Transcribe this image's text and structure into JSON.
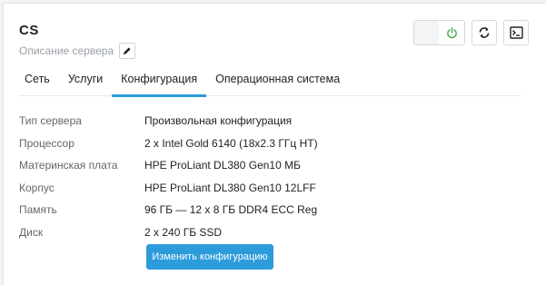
{
  "server": {
    "name": "CS",
    "description": "Описание сервера"
  },
  "icons": {
    "edit": "pencil-icon",
    "power": "power-icon",
    "reboot": "refresh-icon",
    "console": "terminal-icon"
  },
  "colors": {
    "accent": "#2d9cdb",
    "power_on": "#4caf50"
  },
  "tabs": [
    {
      "label": "Сеть",
      "active": false
    },
    {
      "label": "Услуги",
      "active": false
    },
    {
      "label": "Конфигурация",
      "active": true
    },
    {
      "label": "Операционная система",
      "active": false
    }
  ],
  "config": [
    {
      "key": "Тип сервера",
      "value": "Произвольная конфигурация"
    },
    {
      "key": "Процессор",
      "value": "2 x Intel Gold 6140 (18x2.3 ГГц HT)"
    },
    {
      "key": "Материнская плата",
      "value": "HPE ProLiant DL380 Gen10 МБ"
    },
    {
      "key": "Корпус",
      "value": "HPE ProLiant DL380 Gen10 12LFF"
    },
    {
      "key": "Память",
      "value": "96 ГБ — 12 x 8 ГБ DDR4 ECC Reg"
    },
    {
      "key": "Диск",
      "value": "2 x 240 ГБ SSD"
    }
  ],
  "actions": {
    "change_config": "Изменить конфигурацию"
  }
}
